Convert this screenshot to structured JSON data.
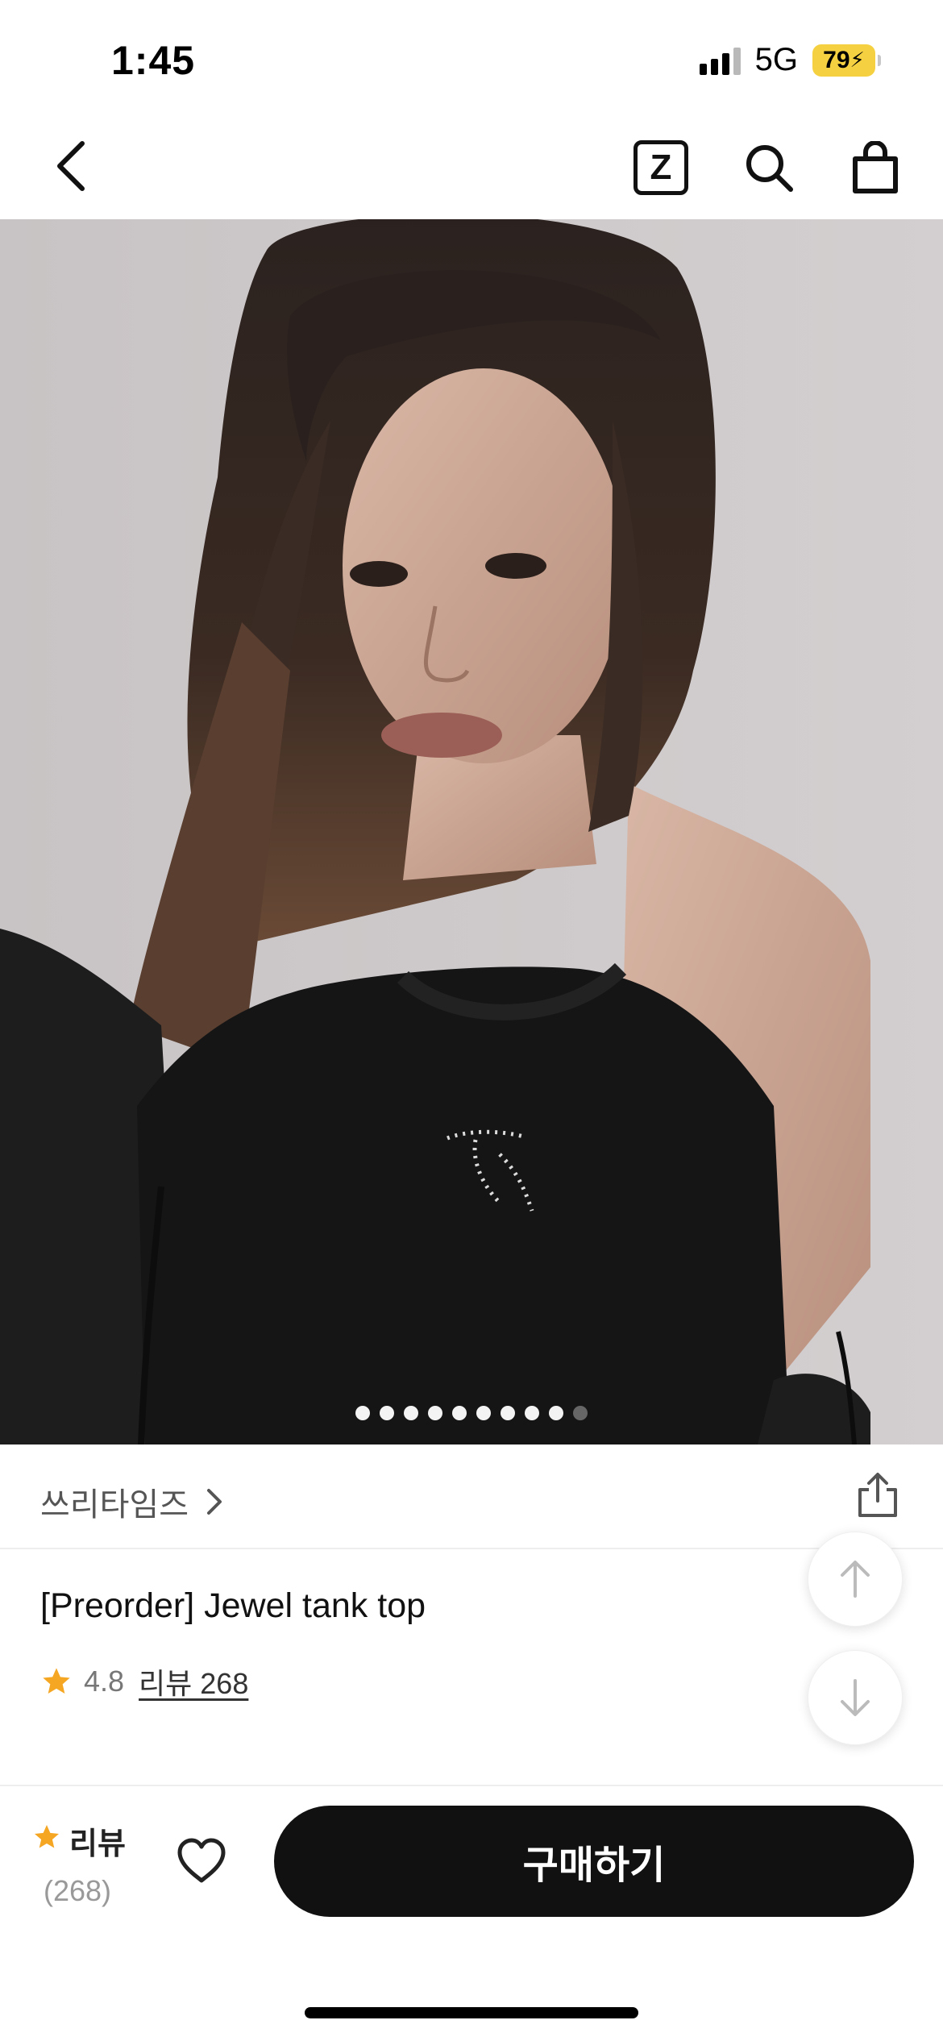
{
  "status_bar": {
    "time": "1:45",
    "network": "5G",
    "battery": "79"
  },
  "nav": {
    "z_label": "Z"
  },
  "gallery": {
    "total_images": 10,
    "active_index": 9
  },
  "brand": {
    "name": "쓰리타임즈"
  },
  "product": {
    "title": "[Preorder] Jewel tank top",
    "rating": "4.8",
    "review_link": "리뷰 268"
  },
  "action_bar": {
    "review_label": "리뷰",
    "review_count": "(268)",
    "buy_label": "구매하기"
  },
  "colors": {
    "accent_star": "#F5A623",
    "buy_button": "#111111",
    "battery_fill": "#F5D142"
  }
}
